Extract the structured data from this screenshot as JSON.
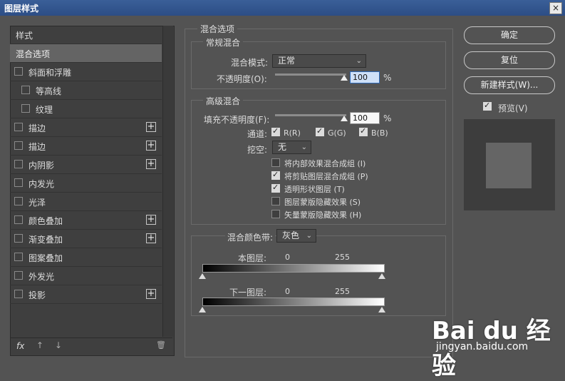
{
  "window": {
    "title": "图层样式",
    "close": "×"
  },
  "left": {
    "header": "样式",
    "selected": "混合选项",
    "items": [
      {
        "label": "斜面和浮雕",
        "plus": false
      },
      {
        "label": "等高线",
        "plus": false
      },
      {
        "label": "纹理",
        "plus": false
      },
      {
        "label": "描边",
        "plus": true
      },
      {
        "label": "描边",
        "plus": true
      },
      {
        "label": "内阴影",
        "plus": true
      },
      {
        "label": "内发光",
        "plus": false
      },
      {
        "label": "光泽",
        "plus": false
      },
      {
        "label": "颜色叠加",
        "plus": true
      },
      {
        "label": "渐变叠加",
        "plus": true
      },
      {
        "label": "图案叠加",
        "plus": false
      },
      {
        "label": "外发光",
        "plus": false
      },
      {
        "label": "投影",
        "plus": true
      }
    ],
    "footer": {
      "fx": "fx",
      "up": "↑",
      "down": "↓",
      "trash": "🗑"
    }
  },
  "blend": {
    "section_title": "混合选项",
    "general": {
      "title": "常规混合",
      "mode_label": "混合模式:",
      "mode_value": "正常",
      "opacity_label": "不透明度(O):",
      "opacity_value": "100",
      "percent": "%"
    },
    "advanced": {
      "title": "高级混合",
      "fill_label": "填充不透明度(F):",
      "fill_value": "100",
      "percent": "%",
      "channels_label": "通道:",
      "ch_r": "R(R)",
      "ch_g": "G(G)",
      "ch_b": "B(B)",
      "knockout_label": "挖空:",
      "knockout_value": "无",
      "options": [
        {
          "label": "将内部效果混合成组 (I)",
          "checked": false
        },
        {
          "label": "将剪贴图层混合成组 (P)",
          "checked": true
        },
        {
          "label": "透明形状图层 (T)",
          "checked": true
        },
        {
          "label": "图层蒙版隐藏效果 (S)",
          "checked": false
        },
        {
          "label": "矢量蒙版隐藏效果 (H)",
          "checked": false
        }
      ]
    },
    "blend_if": {
      "label": "混合颜色带:",
      "value": "灰色",
      "this_layer": "本图层:",
      "underlying": "下一图层:",
      "min": "0",
      "max": "255"
    }
  },
  "buttons": {
    "ok": "确定",
    "reset": "复位",
    "new_style": "新建样式(W)...",
    "preview": "预览(V)"
  },
  "watermark": {
    "brand": "Bai du 经验",
    "url": "jingyan.baidu.com"
  }
}
